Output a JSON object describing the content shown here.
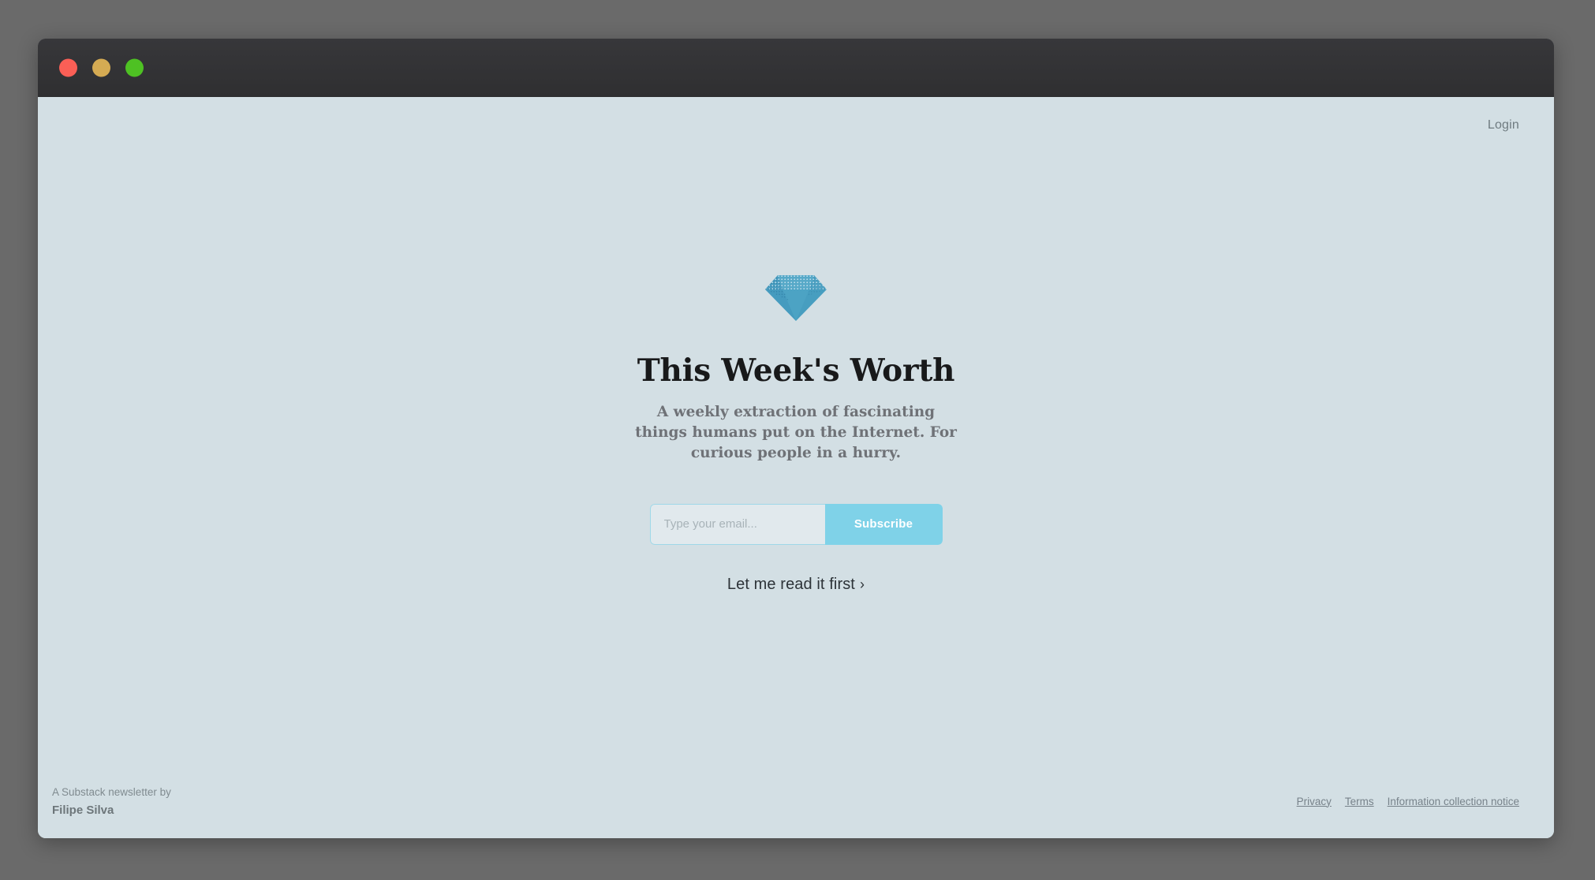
{
  "window": {
    "traffic_lights": [
      {
        "name": "close",
        "color": "#fb5f56"
      },
      {
        "name": "minimize",
        "color": "#d5ab53"
      },
      {
        "name": "maximize",
        "color": "#4ec123"
      }
    ],
    "titlebar_color": "#333335",
    "page_background": "#d3dfe4"
  },
  "topbar": {
    "login_label": "Login"
  },
  "hero": {
    "logo_icon": "diamond-icon",
    "logo_colors": {
      "crown": "#57a9c8",
      "pavilion": "#4ca3c4",
      "facet_dark": "#2f7da3",
      "facet_dots": "#cfe6f1"
    },
    "title": "This Week's Worth",
    "description": "A weekly extraction of fascinating things humans put on the Internet. For curious people in a hurry.",
    "email_placeholder": "Type your email...",
    "email_value": "",
    "subscribe_label": "Subscribe",
    "subscribe_color": "#7fd2e8",
    "read_first_label": "Let me read it first",
    "read_first_chevron": "›"
  },
  "footer": {
    "byline_prefix": "A Substack newsletter by",
    "author": "Filipe Silva",
    "legal_links": [
      {
        "label": "Privacy"
      },
      {
        "label": "Terms"
      },
      {
        "label": "Information collection notice"
      }
    ]
  }
}
